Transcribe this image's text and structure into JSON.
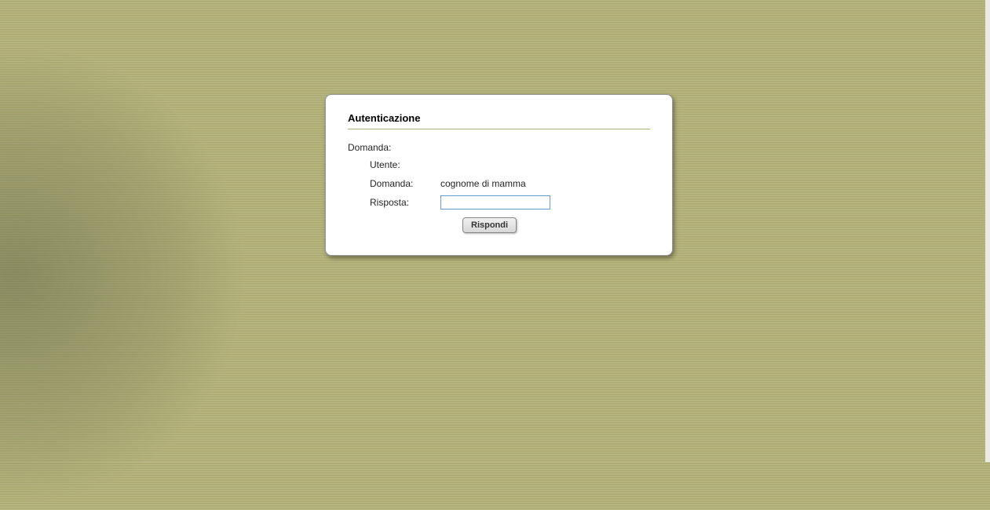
{
  "auth": {
    "title": "Autenticazione",
    "section_label": "Domanda:",
    "rows": {
      "user_label": "Utente:",
      "user_value": "",
      "question_label": "Domanda:",
      "question_value": "cognome di mamma",
      "answer_label": "Risposta:",
      "answer_value": ""
    },
    "submit_label": "Rispondi"
  }
}
